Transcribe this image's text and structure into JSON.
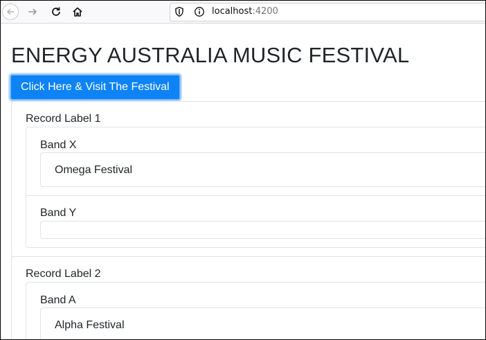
{
  "browser": {
    "url_host": "localhost",
    "url_port": ":4200"
  },
  "page": {
    "title": "ENERGY AUSTRALIA MUSIC FESTIVAL",
    "button_label": "Click Here & Visit The Festival",
    "record_labels": [
      {
        "name": "Record Label 1",
        "bands": [
          {
            "name": "Band X",
            "festival": "Omega Festival"
          },
          {
            "name": "Band Y",
            "festival": ""
          }
        ]
      },
      {
        "name": "Record Label 2",
        "bands": [
          {
            "name": "Band A",
            "festival": "Alpha Festival"
          }
        ]
      }
    ]
  },
  "colors": {
    "primary": "#0d83f5",
    "border": "#dfe2e6"
  }
}
